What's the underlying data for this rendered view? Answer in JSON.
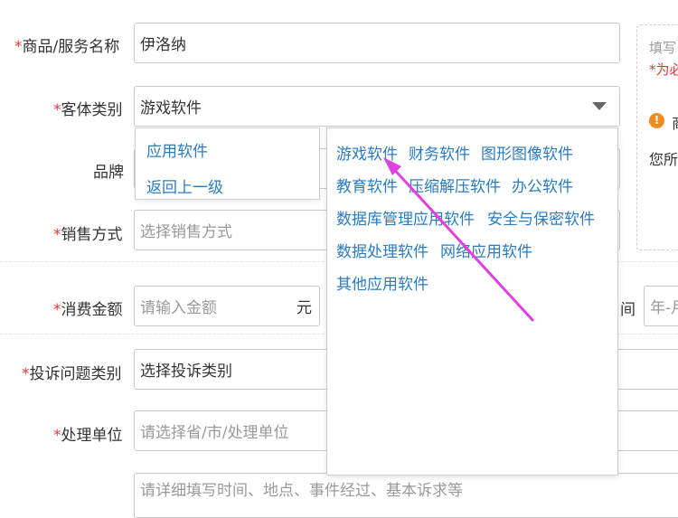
{
  "form": {
    "required_mark": "*",
    "name_label": "商品/服务名称",
    "name_value": "伊洛纳",
    "category_label": "客体类别",
    "category_value": "游戏软件",
    "brand_label": "品牌",
    "sale_label": "销售方式",
    "sale_placeholder": "选择销售方式",
    "amount_label": "消费金额",
    "amount_placeholder": "请输入金额",
    "amount_unit": "元",
    "time_label_partial": "间",
    "time_placeholder_partial": "年-月",
    "complaint_label": "投诉问题类别",
    "complaint_placeholder": "选择投诉类别",
    "unit_label": "处理单位",
    "unit_placeholder": "请选择省/市/处理单位",
    "detail_placeholder": "请详细填写时间、地点、事件经过、基本诉求等"
  },
  "dropdown": {
    "left_items": [
      "应用软件",
      "返回上一级"
    ],
    "rows": [
      [
        "游戏软件",
        "财务软件",
        "图形图像软件"
      ],
      [
        "教育软件",
        "压缩解压软件",
        "办公软件"
      ],
      [
        "数据库管理应用软件",
        "安全与保密软件"
      ],
      [
        "数据处理软件",
        "网络应用软件"
      ],
      [
        "其他应用软件"
      ]
    ]
  },
  "side_panel": {
    "line1": "填写",
    "line2": "*为必",
    "line3": "商",
    "line4": "您所"
  },
  "colors": {
    "accent_link": "#2a7bc2",
    "required": "#e4393c",
    "warning": "#f08c1c",
    "arrow": "#e040e0"
  }
}
